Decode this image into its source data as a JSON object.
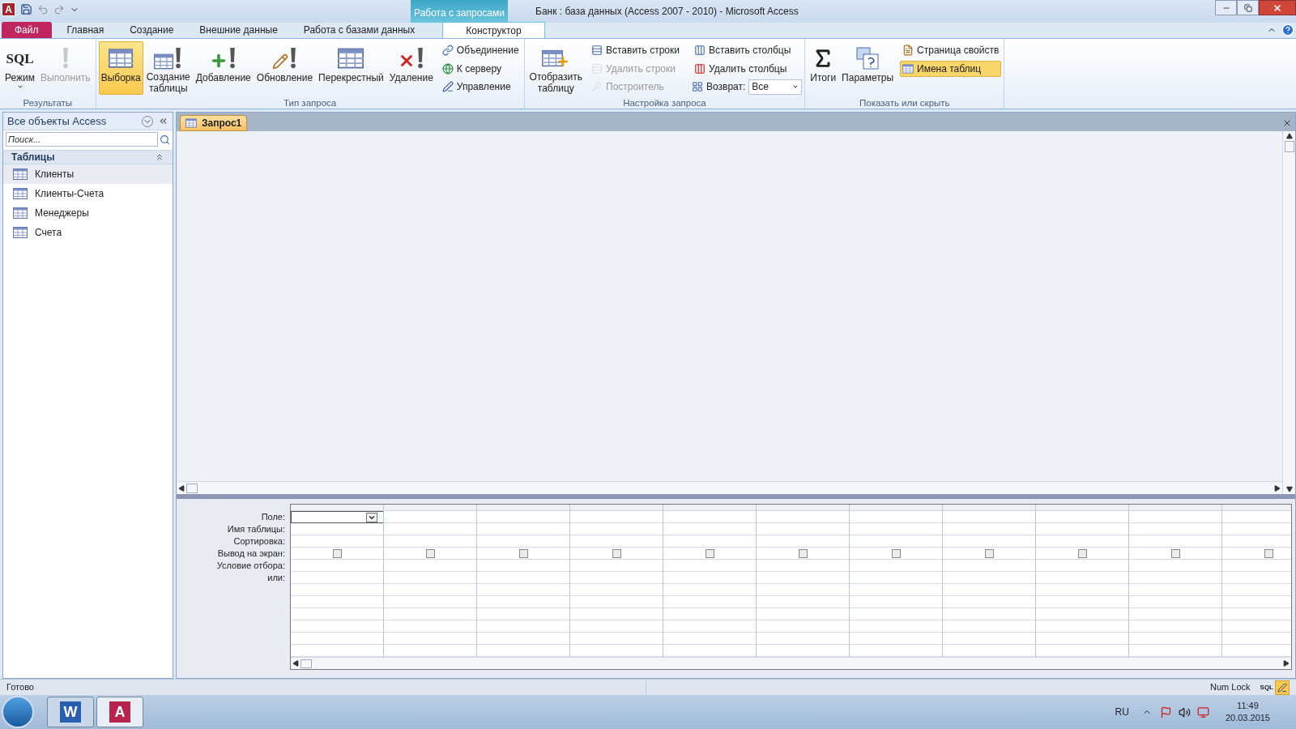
{
  "window": {
    "title": "Банк : база данных (Access 2007 - 2010)  -  Microsoft Access",
    "app_glyph": "A",
    "context_tab": "Работа с запросами"
  },
  "tabs": [
    {
      "label": "Файл",
      "kind": "file",
      "selected": false
    },
    {
      "label": "Главная",
      "kind": "normal",
      "selected": false
    },
    {
      "label": "Создание",
      "kind": "normal",
      "selected": false
    },
    {
      "label": "Внешние данные",
      "kind": "normal",
      "selected": false
    },
    {
      "label": "Работа с базами данных",
      "kind": "normal",
      "selected": false
    },
    {
      "label": "Конструктор",
      "kind": "context",
      "selected": true
    }
  ],
  "ribbon": {
    "groups": [
      {
        "label": "Результаты",
        "large": [
          {
            "label": "Режим",
            "icon_text": "SQL",
            "menu": true,
            "selected": false,
            "disabled": false
          },
          {
            "label": "Выполнить",
            "menu": false,
            "selected": false,
            "disabled": true
          }
        ]
      },
      {
        "label": "Тип запроса",
        "large": [
          {
            "label": "Выборка",
            "menu": false,
            "selected": true,
            "disabled": false
          },
          {
            "label": "Создание\nтаблицы",
            "menu": false,
            "selected": false,
            "disabled": false
          },
          {
            "label": "Добавление",
            "menu": false,
            "selected": false,
            "disabled": false
          },
          {
            "label": "Обновление",
            "menu": false,
            "selected": false,
            "disabled": false
          },
          {
            "label": "Перекрестный",
            "menu": false,
            "selected": false,
            "disabled": false
          },
          {
            "label": "Удаление",
            "menu": false,
            "selected": false,
            "disabled": false
          }
        ],
        "small": [
          {
            "kind": "button",
            "label": "Объединение",
            "selected": false,
            "disabled": false
          },
          {
            "kind": "button",
            "label": "К серверу",
            "selected": false,
            "disabled": false
          },
          {
            "kind": "button",
            "label": "Управление",
            "selected": false,
            "disabled": false
          }
        ]
      },
      {
        "label": "Настройка запроса",
        "large": [
          {
            "label": "Отобразить\nтаблицу",
            "menu": false,
            "selected": false,
            "disabled": false
          }
        ],
        "small": [
          {
            "kind": "button",
            "label": "Вставить строки",
            "selected": false,
            "disabled": false
          },
          {
            "kind": "button",
            "label": "Удалить строки",
            "selected": false,
            "disabled": true
          },
          {
            "kind": "button",
            "label": "Построитель",
            "selected": false,
            "disabled": true
          },
          {
            "kind": "button",
            "label": "Вставить столбцы",
            "selected": false,
            "disabled": false
          },
          {
            "kind": "button",
            "label": "Удалить столбцы",
            "selected": false,
            "disabled": false
          },
          {
            "kind": "combo",
            "label": "Возврат:",
            "value": "Все"
          }
        ]
      },
      {
        "label": "Показать или скрыть",
        "large": [
          {
            "label": "Итоги",
            "menu": false,
            "selected": false,
            "disabled": false
          },
          {
            "label": "Параметры",
            "menu": false,
            "selected": false,
            "disabled": false
          }
        ],
        "small": [
          {
            "kind": "button",
            "label": "Страница свойств",
            "selected": false,
            "disabled": false
          },
          {
            "kind": "button",
            "label": "Имена таблиц",
            "selected": true,
            "disabled": false
          }
        ]
      }
    ]
  },
  "nav": {
    "title": "Все объекты Access",
    "search": {
      "placeholder": "Поиск..."
    },
    "group": "Таблицы",
    "items": [
      {
        "label": "Клиенты",
        "selected": true
      },
      {
        "label": "Клиенты-Счета",
        "selected": false
      },
      {
        "label": "Менеджеры",
        "selected": false
      },
      {
        "label": "Счета",
        "selected": false
      }
    ]
  },
  "document": {
    "tabs": [
      {
        "label": "Запрос1",
        "selected": true
      }
    ]
  },
  "grid": {
    "row_labels": [
      "Поле:",
      "Имя таблицы:",
      "Сортировка:",
      "Вывод на экран:",
      "Условие отбора:",
      "или:"
    ],
    "columns": [
      {
        "show": false,
        "active": true
      },
      {
        "show": false,
        "active": false
      },
      {
        "show": false,
        "active": false
      },
      {
        "show": false,
        "active": false
      },
      {
        "show": false,
        "active": false
      },
      {
        "show": false,
        "active": false
      },
      {
        "show": false,
        "active": false
      },
      {
        "show": false,
        "active": false
      },
      {
        "show": false,
        "active": false
      },
      {
        "show": false,
        "active": false
      },
      {
        "show": false,
        "active": false
      }
    ]
  },
  "status_bar": {
    "text": "Готово",
    "indicator": "Num Lock",
    "views": [
      {
        "label": "SQL",
        "kind": "sql",
        "selected": false
      },
      {
        "kind": "design",
        "selected": true
      }
    ]
  },
  "taskbar": {
    "apps": [
      {
        "glyph": "W",
        "kind": "word",
        "selected": false
      },
      {
        "glyph": "A",
        "kind": "access",
        "selected": true
      }
    ],
    "language": "RU",
    "time": "11:49",
    "date": "20.03.2015"
  }
}
